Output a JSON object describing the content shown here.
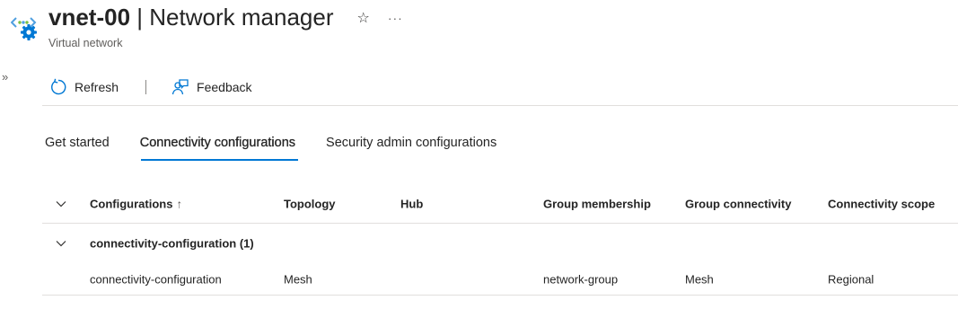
{
  "header": {
    "resource_name": "vnet-00",
    "separator": "|",
    "page_name": "Network manager",
    "subtitle": "Virtual network",
    "favorite_icon": "star-outline-icon",
    "more_icon": "more-ellipsis-icon",
    "more_glyph": "···",
    "favorite_glyph": "☆"
  },
  "sidebar": {
    "expand_glyph": "»"
  },
  "toolbar": {
    "refresh_label": "Refresh",
    "feedback_label": "Feedback"
  },
  "tabs": [
    {
      "label": "Get started",
      "active": false
    },
    {
      "label": "Connectivity configurations",
      "active": true
    },
    {
      "label": "Security admin configurations",
      "active": false
    }
  ],
  "grid": {
    "columns": [
      "Configurations",
      "Topology",
      "Hub",
      "Group membership",
      "Group connectivity",
      "Connectivity scope"
    ],
    "sort_glyph": "↑",
    "groups": [
      {
        "label": "connectivity-configuration (1)",
        "rows": [
          {
            "configuration": "connectivity-configuration",
            "topology": "Mesh",
            "hub": "",
            "group_membership": "network-group",
            "group_connectivity": "Mesh",
            "connectivity_scope": "Regional"
          }
        ]
      }
    ]
  },
  "colors": {
    "accent": "#0078d4",
    "text": "#242424",
    "muted": "#605e5c",
    "divider": "#e1dfdd"
  }
}
